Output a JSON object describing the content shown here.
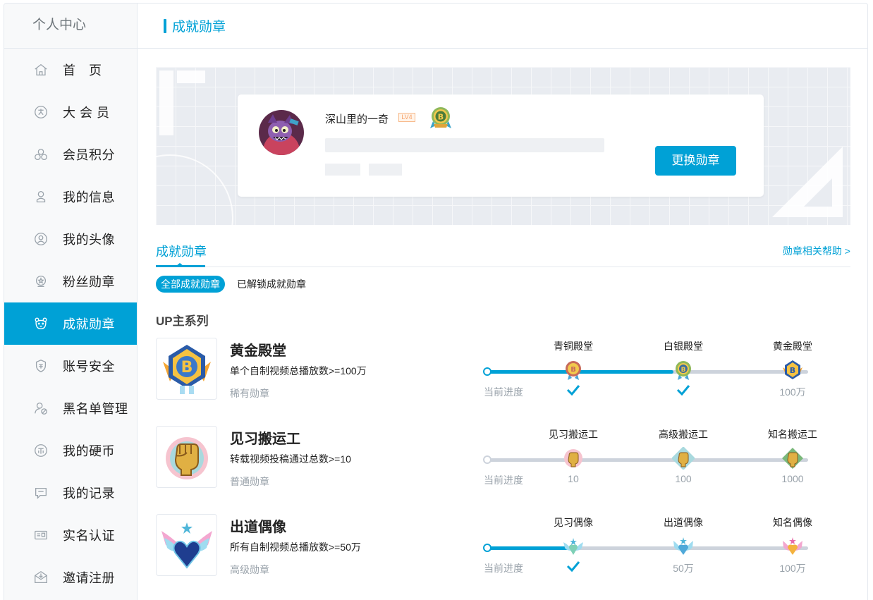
{
  "sidebar": {
    "title": "个人中心",
    "items": [
      {
        "label": "首　页",
        "icon": "home-icon"
      },
      {
        "label": "大 会 员",
        "icon": "vip-icon"
      },
      {
        "label": "会员积分",
        "icon": "points-icon"
      },
      {
        "label": "我的信息",
        "icon": "user-icon"
      },
      {
        "label": "我的头像",
        "icon": "avatar-icon"
      },
      {
        "label": "粉丝勋章",
        "icon": "fan-medal-icon"
      },
      {
        "label": "成就勋章",
        "icon": "bear-icon",
        "active": true
      },
      {
        "label": "账号安全",
        "icon": "shield-icon"
      },
      {
        "label": "黑名单管理",
        "icon": "blacklist-icon"
      },
      {
        "label": "我的硬币",
        "icon": "coin-icon"
      },
      {
        "label": "我的记录",
        "icon": "record-icon"
      },
      {
        "label": "实名认证",
        "icon": "id-card-icon"
      },
      {
        "label": "邀请注册",
        "icon": "invite-icon"
      }
    ]
  },
  "header": {
    "title": "成就勋章"
  },
  "banner": {
    "username": "深山里的一奇",
    "level": "LV4",
    "change_button": "更换勋章"
  },
  "tabs": {
    "active": "成就勋章",
    "help": "勋章相关帮助 >"
  },
  "filters": {
    "all": "全部成就勋章",
    "unlocked": "已解锁成就勋章"
  },
  "series_title": "UP主系列",
  "progress_label": "当前进度",
  "medals": [
    {
      "name": "黄金殿堂",
      "desc": "单个自制视频总播放数>=100万",
      "rarity": "稀有勋章",
      "progress": 0.58,
      "levels": [
        {
          "name": "青铜殿堂",
          "value": "",
          "done": true
        },
        {
          "name": "白银殿堂",
          "value": "",
          "done": true
        },
        {
          "name": "黄金殿堂",
          "value": "100万",
          "done": false
        }
      ]
    },
    {
      "name": "见习搬运工",
      "desc": "转载视频投稿通过总数>=10",
      "rarity": "普通勋章",
      "progress": 0,
      "levels": [
        {
          "name": "见习搬运工",
          "value": "10",
          "done": false
        },
        {
          "name": "高级搬运工",
          "value": "100",
          "done": false
        },
        {
          "name": "知名搬运工",
          "value": "1000",
          "done": false
        }
      ]
    },
    {
      "name": "出道偶像",
      "desc": "所有自制视频总播放数>=50万",
      "rarity": "高级勋章",
      "progress": 0.27,
      "levels": [
        {
          "name": "见习偶像",
          "value": "",
          "done": true
        },
        {
          "name": "出道偶像",
          "value": "50万",
          "done": false
        },
        {
          "name": "知名偶像",
          "value": "100万",
          "done": false
        }
      ]
    }
  ],
  "colors": {
    "accent": "#00a1d6",
    "track": "#cdd3dc",
    "muted": "#99a2aa"
  }
}
